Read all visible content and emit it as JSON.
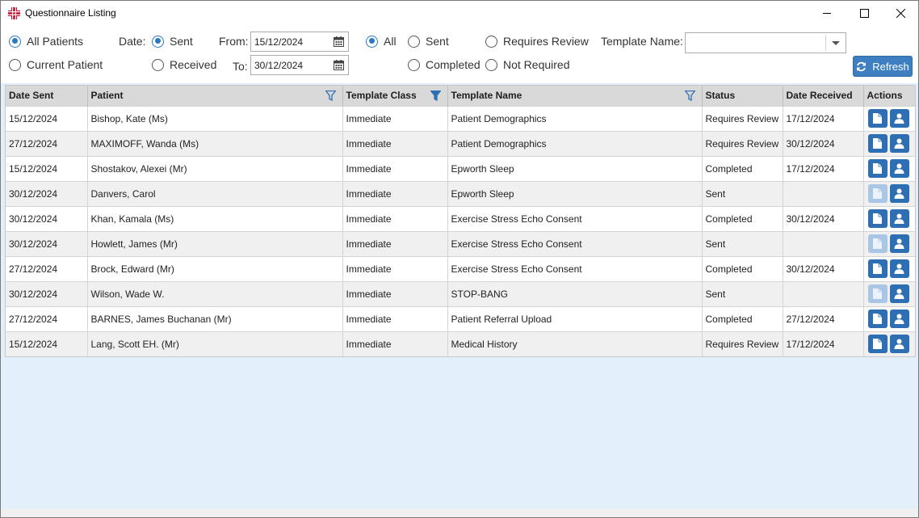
{
  "window": {
    "title": "Questionnaire Listing"
  },
  "filters": {
    "patient_scope": [
      {
        "label": "All Patients",
        "checked": true
      },
      {
        "label": "Current Patient",
        "checked": false
      }
    ],
    "date_label": "Date:",
    "date_type": [
      {
        "label": "Sent",
        "checked": true
      },
      {
        "label": "Received",
        "checked": false
      }
    ],
    "from_label": "From:",
    "from_value": "15/12/2024",
    "to_label": "To:",
    "to_value": "30/12/2024",
    "status": [
      {
        "label": "All",
        "checked": true
      },
      {
        "label": "Sent",
        "checked": false
      },
      {
        "label": "Requires Review",
        "checked": false
      },
      {
        "label": "Completed",
        "checked": false
      },
      {
        "label": "Not Required",
        "checked": false
      }
    ],
    "template_name_label": "Template Name:",
    "template_name_value": "",
    "refresh_label": "Refresh"
  },
  "table": {
    "columns": [
      "Date Sent",
      "Patient",
      "Template Class",
      "Template Name",
      "Status",
      "Date Received",
      "Actions"
    ],
    "rows": [
      {
        "date_sent": "15/12/2024",
        "patient": "Bishop, Kate (Ms)",
        "template_class": "Immediate",
        "template_name": "Patient Demographics",
        "status": "Requires Review",
        "date_received": "17/12/2024",
        "doc_enabled": true
      },
      {
        "date_sent": "27/12/2024",
        "patient": "MAXIMOFF, Wanda (Ms)",
        "template_class": "Immediate",
        "template_name": "Patient Demographics",
        "status": "Requires Review",
        "date_received": "30/12/2024",
        "doc_enabled": true
      },
      {
        "date_sent": "15/12/2024",
        "patient": "Shostakov, Alexei (Mr)",
        "template_class": "Immediate",
        "template_name": "Epworth Sleep",
        "status": "Completed",
        "date_received": "17/12/2024",
        "doc_enabled": true
      },
      {
        "date_sent": "30/12/2024",
        "patient": "Danvers, Carol",
        "template_class": "Immediate",
        "template_name": "Epworth Sleep",
        "status": "Sent",
        "date_received": "",
        "doc_enabled": false
      },
      {
        "date_sent": "30/12/2024",
        "patient": "Khan, Kamala (Ms)",
        "template_class": "Immediate",
        "template_name": "Exercise Stress Echo Consent",
        "status": "Completed",
        "date_received": "30/12/2024",
        "doc_enabled": true
      },
      {
        "date_sent": "30/12/2024",
        "patient": "Howlett, James (Mr)",
        "template_class": "Immediate",
        "template_name": "Exercise Stress Echo Consent",
        "status": "Sent",
        "date_received": "",
        "doc_enabled": false
      },
      {
        "date_sent": "27/12/2024",
        "patient": "Brock, Edward (Mr)",
        "template_class": "Immediate",
        "template_name": "Exercise Stress Echo Consent",
        "status": "Completed",
        "date_received": "30/12/2024",
        "doc_enabled": true
      },
      {
        "date_sent": "30/12/2024",
        "patient": "Wilson, Wade W.",
        "template_class": "Immediate",
        "template_name": "STOP-BANG",
        "status": "Sent",
        "date_received": "",
        "doc_enabled": false
      },
      {
        "date_sent": "27/12/2024",
        "patient": "BARNES, James Buchanan (Mr)",
        "template_class": "Immediate",
        "template_name": "Patient Referral Upload",
        "status": "Completed",
        "date_received": "27/12/2024",
        "doc_enabled": true
      },
      {
        "date_sent": "15/12/2024",
        "patient": "Lang, Scott EH. (Mr)",
        "template_class": "Immediate",
        "template_name": "Medical History",
        "status": "Requires Review",
        "date_received": "17/12/2024",
        "doc_enabled": true
      }
    ]
  },
  "colors": {
    "accent": "#2b79c2",
    "button": "#2e6fb3",
    "button_disabled": "#a9c6e4",
    "content_bg": "#e3f0fb"
  },
  "icons": {
    "app": "red-cross-icon",
    "calendar": "calendar-icon",
    "filter": "funnel-icon",
    "document": "document-icon",
    "patient": "person-icon",
    "refresh": "refresh-icon"
  }
}
